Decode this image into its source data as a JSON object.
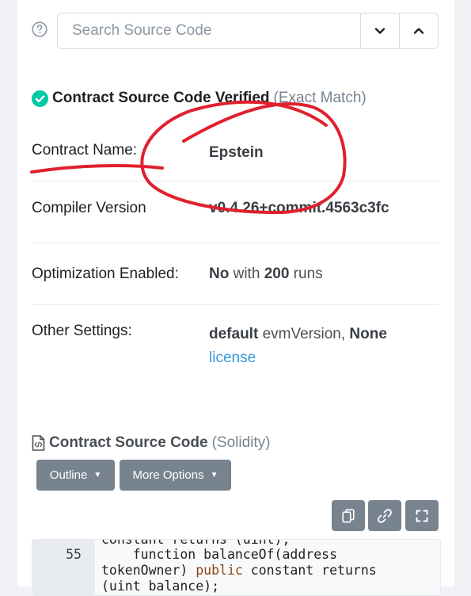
{
  "search": {
    "placeholder": "Search Source Code"
  },
  "verification": {
    "title": "Contract Source Code Verified",
    "match": "(Exact Match)"
  },
  "details": {
    "contract_name_label": "Contract Name:",
    "contract_name": "Epstein",
    "compiler_label": "Compiler Version",
    "compiler_version": "v0.4.26+commit.4563c3fc",
    "optimization_label": "Optimization Enabled:",
    "optimization_no": "No",
    "optimization_with": "with",
    "optimization_runs": "200",
    "optimization_runs_suffix": "runs",
    "other_label": "Other Settings:",
    "other_default": "default",
    "other_evm": "evmVersion,",
    "other_none": "None",
    "other_license": "license"
  },
  "source": {
    "title": "Contract Source Code",
    "language": "(Solidity)",
    "outline_label": "Outline",
    "more_options_label": "More Options"
  },
  "code": {
    "line_prev": "constant returns (uint);",
    "line_number": "55",
    "line_a": "    function balanceOf(address",
    "line_b_start": "tokenOwner) ",
    "line_b_kw": "public",
    "line_b_end": " constant returns",
    "line_c": "(uint balance);"
  },
  "colors": {
    "verified_green": "#00c9a7",
    "button_gray": "#77838f",
    "link_blue": "#3498db",
    "annotation_red": "#e0202e"
  },
  "icons": [
    "help-circle-icon",
    "chevron-down-icon",
    "chevron-up-icon",
    "check-circle-icon",
    "file-code-icon",
    "copy-icon",
    "link-icon",
    "expand-icon"
  ]
}
